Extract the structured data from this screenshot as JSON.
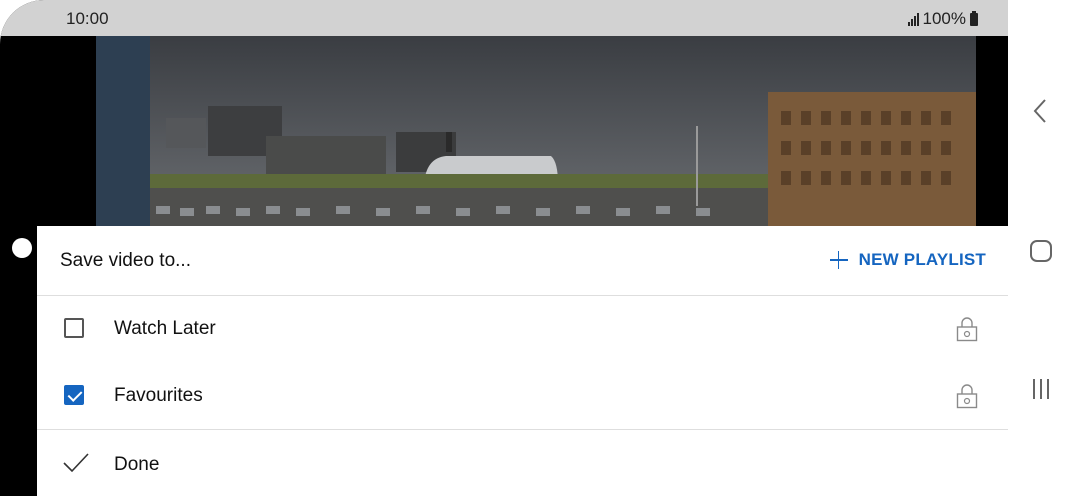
{
  "status_bar": {
    "time": "10:00",
    "battery": "100%"
  },
  "video": {
    "description_icon": "video-thumbnail"
  },
  "dialog": {
    "title": "Save video to...",
    "new_playlist_label": "NEW PLAYLIST",
    "playlists": [
      {
        "label": "Watch Later",
        "checked": false,
        "privacy": "lock-icon"
      },
      {
        "label": "Favourites",
        "checked": true,
        "privacy": "lock-icon"
      }
    ],
    "done_label": "Done"
  },
  "nav": {
    "back": "back-icon",
    "home": "home-icon",
    "recents": "recents-icon"
  },
  "colors": {
    "accent": "#1565c0",
    "status_bar_bg": "#d2d2d2"
  }
}
